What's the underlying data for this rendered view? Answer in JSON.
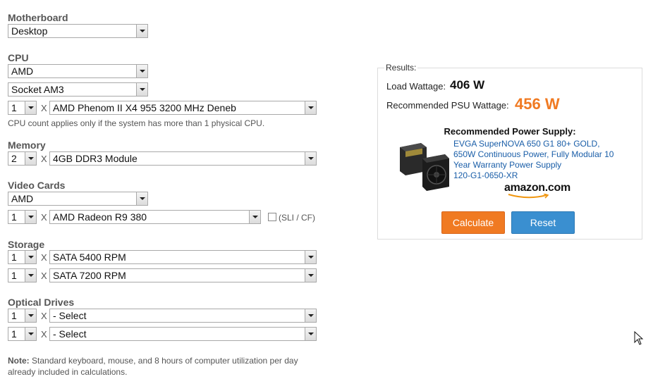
{
  "motherboard": {
    "label": "Motherboard",
    "type": "Desktop"
  },
  "cpu": {
    "label": "CPU",
    "brand": "AMD",
    "socket": "Socket AM3",
    "count": "1",
    "times": "X",
    "model": "AMD Phenom II X4 955 3200 MHz Deneb",
    "hint": "CPU count applies only if the system has more than 1 physical CPU."
  },
  "memory": {
    "label": "Memory",
    "count": "2",
    "times": "X",
    "module": "4GB DDR3 Module"
  },
  "video": {
    "label": "Video Cards",
    "brand": "AMD",
    "count": "1",
    "times": "X",
    "model": "AMD Radeon R9 380",
    "sli_label": "(SLI / CF)",
    "sli_checked": false
  },
  "storage": {
    "label": "Storage",
    "rows": [
      {
        "count": "1",
        "times": "X",
        "type": "SATA 5400 RPM"
      },
      {
        "count": "1",
        "times": "X",
        "type": "SATA 7200 RPM"
      }
    ]
  },
  "optical": {
    "label": "Optical Drives",
    "rows": [
      {
        "count": "1",
        "times": "X",
        "type": "- Select"
      },
      {
        "count": "1",
        "times": "X",
        "type": "- Select"
      }
    ]
  },
  "note": {
    "bold": "Note:",
    "line1": "Standard keyboard, mouse, and 8 hours of computer utilization per day",
    "line2": "already included in calculations."
  },
  "results": {
    "legend": "Results:",
    "load_label": "Load Wattage:",
    "load_value": "406 W",
    "psu_label": "Recommended PSU Wattage:",
    "psu_value": "456 W",
    "recommended_title": "Recommended Power Supply:",
    "product_lines": [
      "EVGA SuperNOVA 650 G1 80+ GOLD,",
      "650W Continuous Power, Fully Modular 10",
      "Year Warranty Power Supply",
      "120-G1-0650-XR"
    ],
    "logo_text": "amazon.com",
    "calculate_label": "Calculate",
    "reset_label": "Reset"
  },
  "colors": {
    "accent_orange": "#f07a22",
    "button_blue": "#3a8fd0",
    "link_blue": "#1a5ea8"
  }
}
